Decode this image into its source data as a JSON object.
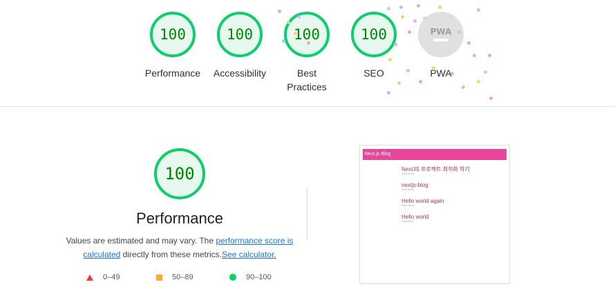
{
  "categories": [
    {
      "label": "Performance",
      "score": "100"
    },
    {
      "label": "Accessibility",
      "score": "100"
    },
    {
      "label": "Best Practices",
      "label_line1": "Best",
      "label_line2": "Practices",
      "score": "100"
    },
    {
      "label": "SEO",
      "score": "100"
    },
    {
      "label": "PWA",
      "badge": "PWA"
    }
  ],
  "detail": {
    "score": "100",
    "title": "Performance",
    "desc_prefix": "Values are estimated and may vary. The ",
    "link_score": "performance score is calculated",
    "desc_mid": " directly from these metrics.",
    "link_calc": "See calculator."
  },
  "legend": [
    {
      "range": "0–49",
      "color": "#ff3333"
    },
    {
      "range": "50–89",
      "color": "#ffaa33"
    },
    {
      "range": "90–100",
      "color": "#0cce6b"
    }
  ],
  "screenshot": {
    "header": "Next.js Blog",
    "posts": [
      {
        "title": "NextJS 프로젝트 최적화 하기",
        "date": "2022-09-10"
      },
      {
        "title": "nextjs-blog",
        "date": "2022-09-01"
      },
      {
        "title": "Hello world again",
        "date": "2022-08-10"
      },
      {
        "title": "Hello world",
        "date": "2022-08-07"
      }
    ]
  },
  "colors": {
    "pass": "#0cce6b",
    "pass_text": "#008800",
    "link": "#1a73e8",
    "header_pink": "#e8469b"
  }
}
